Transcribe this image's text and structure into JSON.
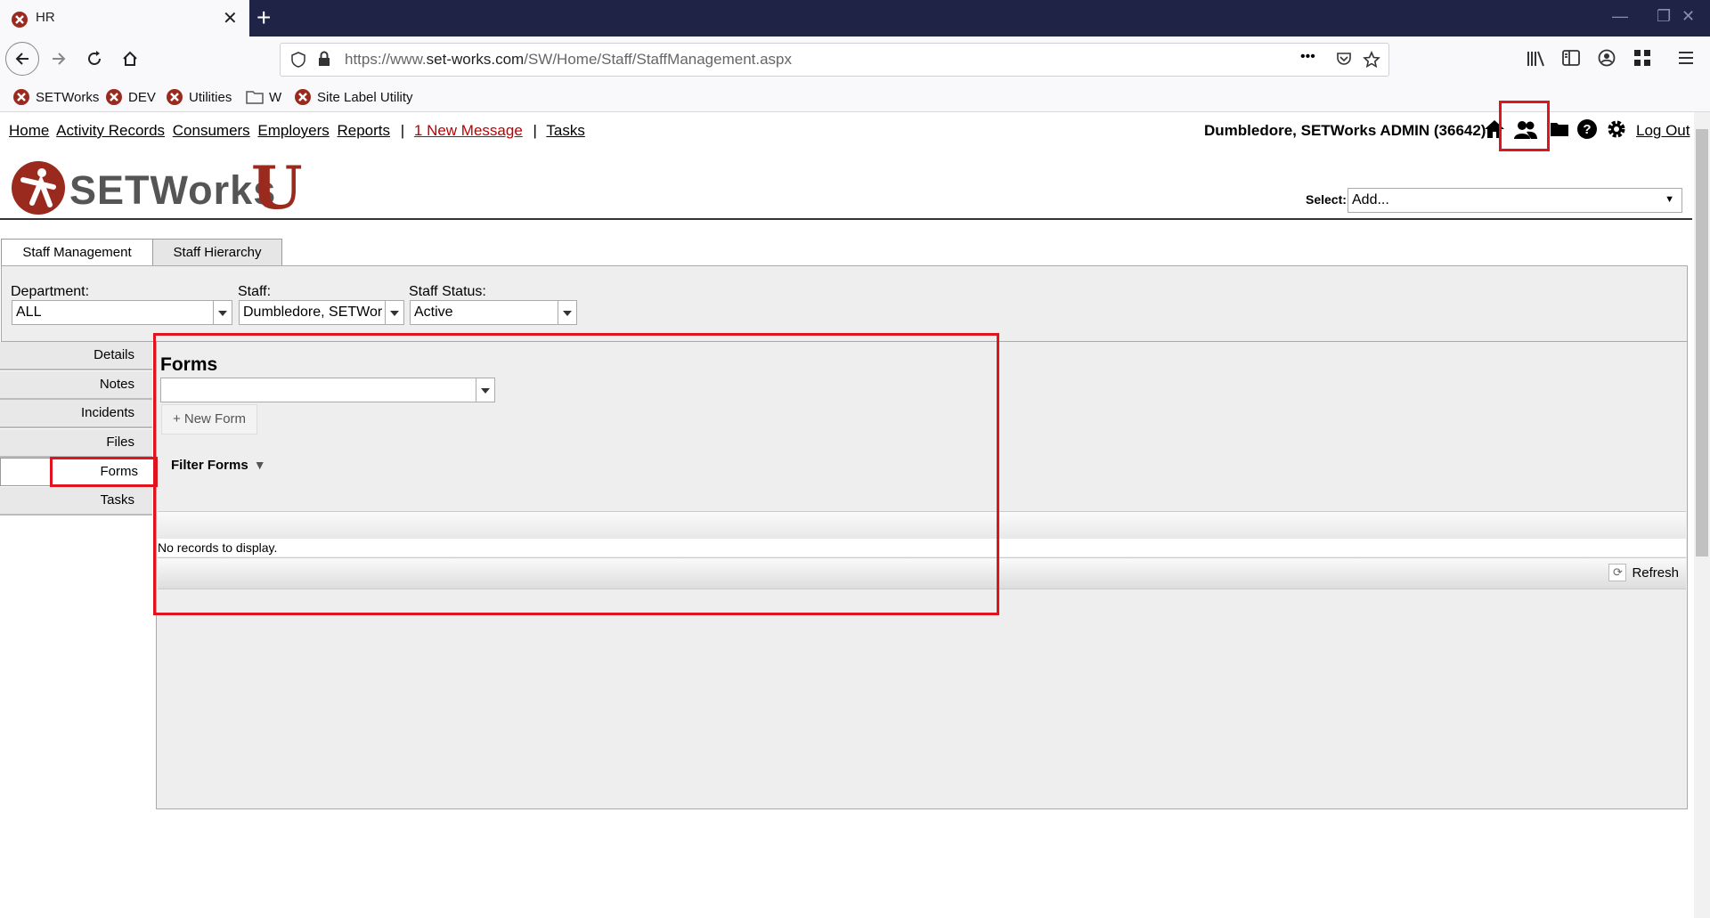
{
  "browser": {
    "tab_title": "HR",
    "tab_close": "✕",
    "new_tab": "+",
    "url_prefix": "https://www.",
    "url_domain": "set-works.com",
    "url_path": "/SW/Home/Staff/StaffManagement.aspx",
    "url_more": "•••"
  },
  "bookmarks": [
    {
      "label": "SETWorks"
    },
    {
      "label": "DEV"
    },
    {
      "label": "Utilities"
    },
    {
      "label": "W"
    },
    {
      "label": "Site Label Utility"
    }
  ],
  "topnav": {
    "home": "Home",
    "activity": "Activity Records",
    "consumers": "Consumers",
    "employers": "Employers",
    "reports": "Reports",
    "sep": "|",
    "message": "1 New Message",
    "tasks": "Tasks"
  },
  "user": {
    "name": "Dumbledore, SETWorks ADMIN",
    "id": "(36642)",
    "logout": "Log Out"
  },
  "logo": {
    "word": "SETWorks",
    "u": "U"
  },
  "select": {
    "label": "Select:",
    "value": "Add..."
  },
  "page_tabs": {
    "staff_management": "Staff Management",
    "staff_hierarchy": "Staff Hierarchy"
  },
  "filters": {
    "department_label": "Department:",
    "department_value": "ALL",
    "staff_label": "Staff:",
    "staff_value": "Dumbledore, SETWor",
    "status_label": "Staff Status:",
    "status_value": "Active"
  },
  "sidebar": [
    "Details",
    "Notes",
    "Incidents",
    "Files",
    "Forms",
    "Tasks"
  ],
  "forms": {
    "title": "Forms",
    "new_form": "+ New Form",
    "filter": "Filter Forms",
    "filter_icon": "▼",
    "no_records": "No records to display.",
    "refresh": "Refresh"
  },
  "colors": {
    "accent_red": "#e0141e",
    "brand": "#9b2a1e",
    "titlebar": "#1f2447"
  }
}
